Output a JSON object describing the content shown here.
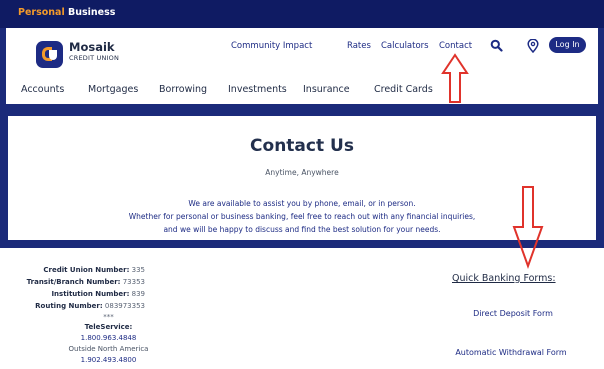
{
  "topbar": {
    "personal": "Personal",
    "business": "Business"
  },
  "logo": {
    "name": "Mosaik",
    "subtitle": "CREDIT UNION"
  },
  "top_links": [
    "Community Impact",
    "Rates",
    "Calculators",
    "Contact"
  ],
  "login_label": "Log In",
  "nav": [
    "Accounts",
    "Mortgages",
    "Borrowing",
    "Investments",
    "Insurance",
    "Credit Cards"
  ],
  "hero": {
    "title": "Contact Us",
    "tagline": "Anytime, Anywhere",
    "line1": "We are available to assist you by phone, email, or in person.",
    "line2": "Whether for personal or business banking, feel free to reach out with any financial inquiries,",
    "line3": "and we will be happy to discuss and find the best solution for your needs."
  },
  "numbers": {
    "cu_label": "Credit Union Number:",
    "cu_value": "335",
    "transit_label": "Transit/Branch Number:",
    "transit_value": "73353",
    "inst_label": "Institution Number:",
    "inst_value": "839",
    "routing_label": "Routing Number:",
    "routing_value": "083973353",
    "separator": "***",
    "teleservice_label": "TeleService:",
    "phone1": "1.800.963.4848",
    "outside_label": "Outside North America",
    "phone2": "1.902.493.4800"
  },
  "quick_forms": {
    "title": "Quick Banking Forms:",
    "links": [
      "Direct Deposit Form",
      "Automatic Withdrawal Form"
    ]
  },
  "colors": {
    "navy": "#1b2a7a",
    "orange": "#f39a2b",
    "annotation_red": "#e0332b"
  }
}
